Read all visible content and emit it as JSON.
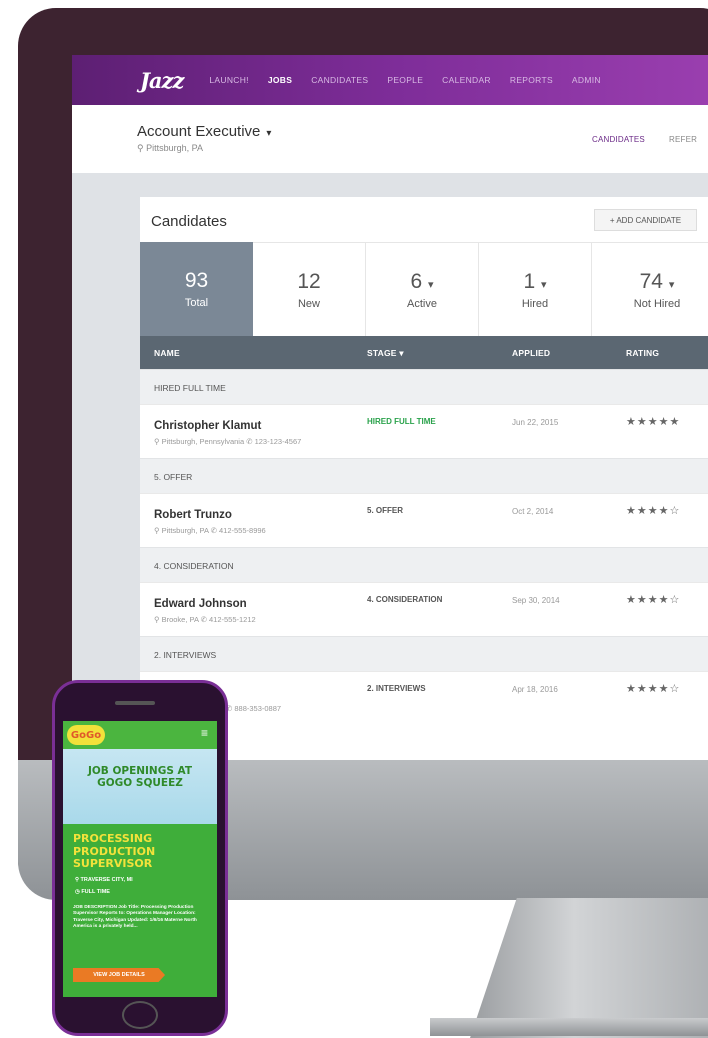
{
  "app": {
    "logo": "Jazz"
  },
  "nav": {
    "items": [
      "LAUNCH!",
      "JOBS",
      "CANDIDATES",
      "PEOPLE",
      "CALENDAR",
      "REPORTS",
      "ADMIN"
    ],
    "active": "JOBS"
  },
  "job": {
    "title": "Account Executive",
    "caret": "▾",
    "location": "⚲ Pittsburgh, PA"
  },
  "subtabs": {
    "candidates": "CANDIDATES",
    "refer": "REFER"
  },
  "panel": {
    "title": "Candidates",
    "add_button": "+ ADD CANDIDATE"
  },
  "stats": [
    {
      "value": "93",
      "label": "Total",
      "caret": ""
    },
    {
      "value": "12",
      "label": "New",
      "caret": ""
    },
    {
      "value": "6",
      "label": "Active",
      "caret": "▾"
    },
    {
      "value": "1",
      "label": "Hired",
      "caret": "▾"
    },
    {
      "value": "74",
      "label": "Not Hired",
      "caret": "▾"
    }
  ],
  "table": {
    "headers": {
      "name": "NAME",
      "stage": "STAGE ▾",
      "applied": "APPLIED",
      "rating": "RATING"
    }
  },
  "groups": [
    "HIRED FULL TIME",
    "5. OFFER",
    "4. CONSIDERATION",
    "2. INTERVIEWS"
  ],
  "candidates": [
    {
      "name": "Christopher Klamut",
      "meta": "⚲ Pittsburgh, Pennsylvania  ✆ 123-123-4567",
      "stage": "HIRED FULL TIME",
      "applied": "Jun 22, 2015",
      "rating": "★★★★★"
    },
    {
      "name": "Robert Trunzo",
      "meta": "⚲ Pittsburgh, PA  ✆ 412-555-8996",
      "stage": "5. OFFER",
      "applied": "Oct 2, 2014",
      "rating": "★★★★☆"
    },
    {
      "name": "Edward Johnson",
      "meta": "⚲ Brooke, PA  ✆ 412-555-1212",
      "stage": "4. CONSIDERATION",
      "applied": "Sep 30, 2014",
      "rating": "★★★★☆"
    },
    {
      "name": "",
      "meta": "✆ 888-353-0887",
      "stage": "2. INTERVIEWS",
      "applied": "Apr 18, 2016",
      "rating": "★★★★☆"
    }
  ],
  "device": {
    "apple_logo": ""
  },
  "phone": {
    "logo": "GoGo",
    "menu": "≡",
    "heading_line1": "JOB OPENINGS AT",
    "heading_line2": "GOGO SQUEEZ",
    "title_line1": "PROCESSING",
    "title_line2": "PRODUCTION",
    "title_line3": "SUPERVISOR",
    "location": "⚲  TRAVERSE CITY, MI",
    "type": "◷  FULL TIME",
    "description": "JOB DESCRIPTION Job Title: Processing Production Supervisor Reports to: Operations Manager Location: Traverse City, Michigan Updated: 1/6/16 Materne North America is a privately held...",
    "button": "VIEW JOB DETAILS"
  }
}
